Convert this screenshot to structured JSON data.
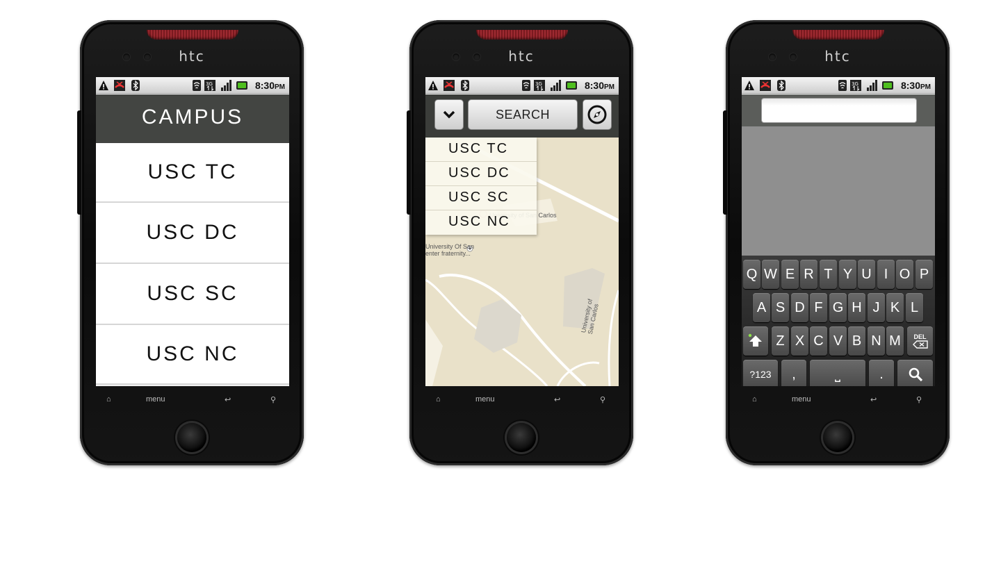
{
  "brand": "htc",
  "status_bar": {
    "time": "8:30",
    "time_suffix": "PM",
    "icons": [
      "warning-icon",
      "missed-call-icon",
      "bluetooth-icon",
      "wifi-icon",
      "3g-icon",
      "signal-icon",
      "battery-icon"
    ]
  },
  "nav": {
    "home": "⌂",
    "menu": "menu",
    "back": "↩",
    "search": "⚲"
  },
  "screen1": {
    "header": "CAMPUS",
    "items": [
      "USC TC",
      "USC DC",
      "USC SC",
      "USC NC"
    ]
  },
  "screen2": {
    "search_label": "SEARCH",
    "dropdown_items": [
      "USC TC",
      "USC DC",
      "USC SC",
      "USC NC"
    ],
    "map_labels": {
      "university_san_carlos": "University of San Carlos",
      "university_of_san": "University Of San",
      "fraternity": "enter fraternity...",
      "road": "University of San Carlos"
    }
  },
  "screen3": {
    "search_value": "",
    "keyboard": {
      "row1": [
        "Q",
        "W",
        "E",
        "R",
        "T",
        "Y",
        "U",
        "I",
        "O",
        "P"
      ],
      "row2": [
        "A",
        "S",
        "D",
        "F",
        "G",
        "H",
        "J",
        "K",
        "L"
      ],
      "row3": [
        "Z",
        "X",
        "C",
        "V",
        "B",
        "N",
        "M"
      ],
      "del": "DEL",
      "sym": "?123",
      "comma": ",",
      "space": "⎵",
      "period": "."
    }
  }
}
